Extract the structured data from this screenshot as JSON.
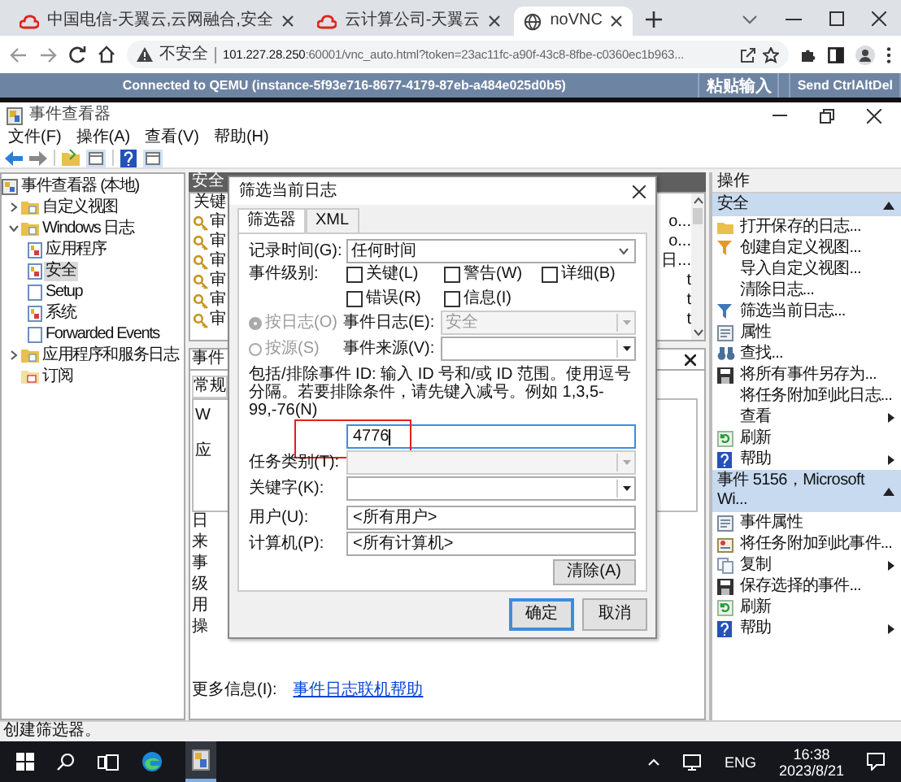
{
  "browser": {
    "tabs": [
      {
        "title": "中国电信-天翼云,云网融合,安全",
        "selected": false,
        "kind": "cloud"
      },
      {
        "title": "云计算公司-天翼云",
        "selected": false,
        "kind": "cloud"
      },
      {
        "title": "noVNC",
        "selected": true,
        "kind": "globe"
      }
    ],
    "address": {
      "security": "不安全",
      "host": "101.227.28.250",
      "rest": ":60001/vnc_auto.html?token=23ac11fc-a90f-43c8-8fbe-c0360ec1b963..."
    }
  },
  "vnc_bar": {
    "status": "Connected to QEMU (instance-5f93e716-8677-4179-87eb-a484e025d0b5)",
    "buttons": [
      "粘贴输入",
      "Send CtrlAltDel"
    ]
  },
  "window": {
    "title": "事件查看器",
    "menu": [
      "文件(F)",
      "操作(A)",
      "查看(V)",
      "帮助(H)"
    ]
  },
  "tree": [
    {
      "label": "事件查看器 (本地)",
      "kind": "viewer",
      "selected": false,
      "children": [
        {
          "label": "自定义视图",
          "kind": "folder",
          "expanded": false,
          "selected": false
        },
        {
          "label": "Windows 日志",
          "kind": "folder",
          "expanded": true,
          "selected": false,
          "children": [
            {
              "label": "应用程序",
              "kind": "log",
              "selected": false
            },
            {
              "label": "安全",
              "kind": "log",
              "selected": true
            },
            {
              "label": "Setup",
              "kind": "plain",
              "selected": false
            },
            {
              "label": "系统",
              "kind": "log",
              "selected": false
            },
            {
              "label": "Forwarded Events",
              "kind": "plain",
              "selected": false
            }
          ]
        },
        {
          "label": "应用程序和服务日志",
          "kind": "folder",
          "expanded": false,
          "selected": false
        },
        {
          "label": "订阅",
          "kind": "subscription",
          "selected": false
        }
      ]
    }
  ],
  "middle": {
    "title": "安全",
    "column_1": "关键",
    "rows": [
      {
        "column_1": "审",
        "column_3": "o..."
      },
      {
        "column_1": "审",
        "column_3": "o..."
      },
      {
        "column_1": "审",
        "column_3": "日..."
      },
      {
        "column_1": "审",
        "column_3": "t"
      },
      {
        "column_1": "审",
        "column_3": "t"
      },
      {
        "column_1": "审",
        "column_3": "t"
      }
    ],
    "detail": {
      "title": "事件",
      "tab": "常规",
      "lines": [
        "W",
        "应"
      ],
      "fields": [
        "日",
        "来",
        "事",
        "级",
        "用",
        "操"
      ],
      "more_info_label": "更多信息(I):",
      "more_info_link": "事件日志联机帮助"
    }
  },
  "dialog": {
    "title": "筛选当前日志",
    "tabs": [
      {
        "label": "筛选器",
        "selected": true
      },
      {
        "label": "XML",
        "selected": false
      }
    ],
    "logged": {
      "label": "记录时间(G):",
      "value": "任何时间"
    },
    "level": {
      "label": "事件级别:",
      "options": [
        {
          "label": "关键(L)",
          "checked": false
        },
        {
          "label": "警告(W)",
          "checked": false
        },
        {
          "label": "详细(B)",
          "checked": false
        },
        {
          "label": "错误(R)",
          "checked": false
        },
        {
          "label": "信息(I)",
          "checked": false
        }
      ]
    },
    "sources": [
      {
        "label": "按日志(O)",
        "selected": true,
        "disabled": true,
        "field_label": "事件日志(E):",
        "value": "安全",
        "field_disabled": true
      },
      {
        "label": "按源(S)",
        "selected": false,
        "disabled": true,
        "field_label": "事件来源(V):",
        "field_disabled": false
      }
    ],
    "event_ids": {
      "hint": "包括/排除事件 ID: 输入 ID 号和/或 ID 范围。使用逗号分隔。若要排除条件，请先键入减号。例如 1,3,5-99,-76(N)",
      "value": "4776",
      "highlighted": true
    },
    "task_category": {
      "label": "任务类别(T):",
      "disabled": true
    },
    "keywords": {
      "label": "关键字(K):",
      "disabled": false
    },
    "user": {
      "label": "用户(U):",
      "value": "<所有用户>"
    },
    "computer": {
      "label": "计算机(P):",
      "value": "<所有计算机>"
    },
    "clear_button": "清除(A)",
    "buttons": [
      {
        "label": "确定",
        "default": true
      },
      {
        "label": "取消",
        "default": false
      }
    ]
  },
  "actions": {
    "title": "操作",
    "sections": [
      {
        "title": "安全",
        "expanded": true,
        "items": [
          {
            "label": "打开保存的日志...",
            "kind": "folder"
          },
          {
            "label": "创建自定义视图...",
            "kind": "funnel"
          },
          {
            "label": "导入自定义视图...",
            "kind": "none"
          },
          {
            "label": "清除日志...",
            "kind": "none"
          },
          {
            "label": "筛选当前日志...",
            "kind": "funnel"
          },
          {
            "label": "属性",
            "kind": "window"
          },
          {
            "label": "查找...",
            "kind": "binoculars"
          },
          {
            "label": "将所有事件另存为...",
            "kind": "save"
          },
          {
            "label": "将任务附加到此日志...",
            "kind": "none"
          },
          {
            "label": "查看",
            "kind": "none",
            "submenu": true
          },
          {
            "label": "刷新",
            "kind": "refresh"
          },
          {
            "label": "帮助",
            "kind": "help",
            "submenu": true
          }
        ]
      },
      {
        "title": "事件 5156，Microsoft Wi...",
        "expanded": true,
        "items": [
          {
            "label": "事件属性",
            "kind": "window"
          },
          {
            "label": "将任务附加到此事件...",
            "kind": "task"
          },
          {
            "label": "复制",
            "kind": "copy",
            "submenu": true
          },
          {
            "label": "保存选择的事件...",
            "kind": "save"
          },
          {
            "label": "刷新",
            "kind": "refresh"
          },
          {
            "label": "帮助",
            "kind": "help",
            "submenu": true
          }
        ]
      }
    ]
  },
  "status_bar": "创建筛选器。",
  "taskbar": {
    "language": "ENG",
    "time": "16:38",
    "date": "2023/8/21"
  }
}
